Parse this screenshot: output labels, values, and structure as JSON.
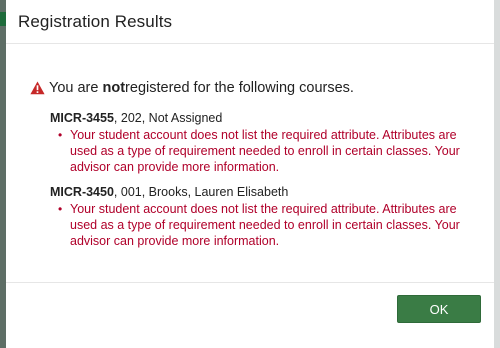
{
  "dialog": {
    "title": "Registration Results",
    "notice_prefix": "You are ",
    "notice_emphasis": "not",
    "notice_suffix": " registered for the following courses.",
    "warning_icon": "warning-triangle-icon",
    "warning_color": "#c62828",
    "error_color": "#b0002a",
    "courses": [
      {
        "code": "MICR-3455",
        "details": ", 202, Not Assigned",
        "error": "Your student account does not list the required attribute. Attributes are used as a type of requirement needed to enroll in certain classes. Your advisor can provide more information."
      },
      {
        "code": "MICR-3450",
        "details": ", 001, Brooks, Lauren Elisabeth",
        "error": "Your student account does not list the required attribute. Attributes are used as a type of requirement needed to enroll in certain classes. Your advisor can provide more information."
      }
    ],
    "ok_label": "OK",
    "ok_color": "#3a7c45"
  }
}
